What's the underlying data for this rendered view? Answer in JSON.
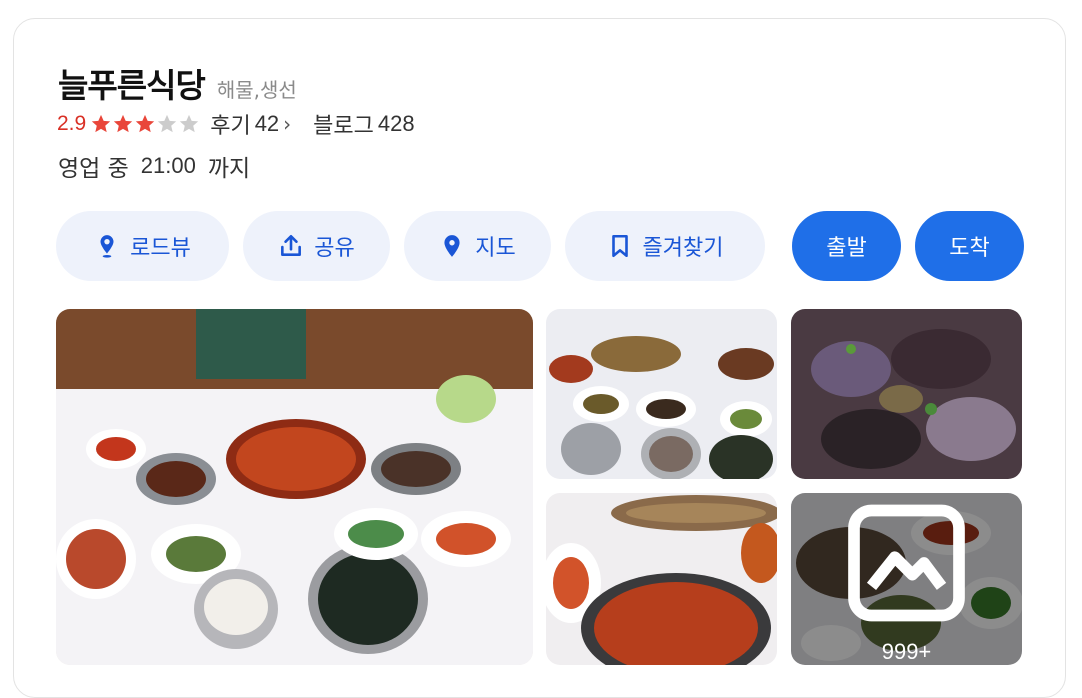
{
  "place": {
    "name": "늘푸른식당",
    "category": "해물,생선"
  },
  "rating": {
    "score": "2.9",
    "stars_filled": 3,
    "stars_total": 5,
    "reviews_label": "후기",
    "reviews_count": "42",
    "blog_label": "블로그",
    "blog_count": "428"
  },
  "hours": {
    "status": "영업 중",
    "time": "21:00",
    "suffix": "까지"
  },
  "actions": {
    "roadview": "로드뷰",
    "share": "공유",
    "map": "지도",
    "bookmark": "즐겨찾기",
    "depart": "출발",
    "arrive": "도착"
  },
  "photos": {
    "more_count": "999+"
  },
  "colors": {
    "accent": "#1f6fe8",
    "rating": "#d93025",
    "star_on": "#e9463a",
    "star_off": "#cccccc"
  }
}
